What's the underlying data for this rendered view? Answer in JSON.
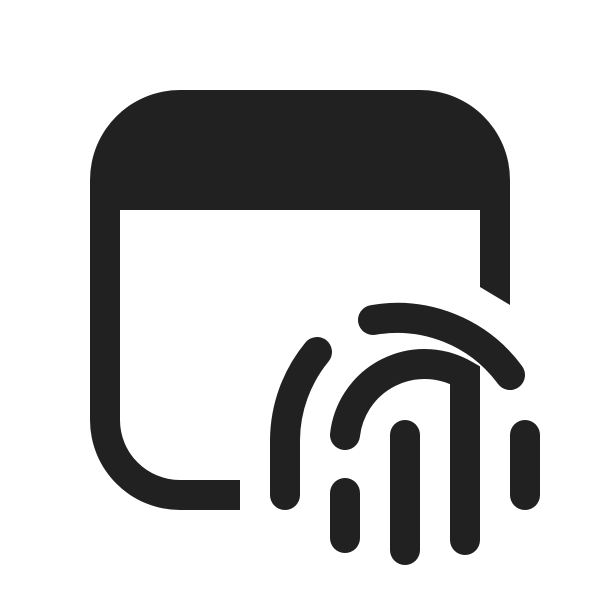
{
  "icon": {
    "name": "window-fingerprint-icon",
    "parts": [
      "window-frame-icon",
      "fingerprint-icon"
    ],
    "colors": {
      "background": "#ffffff",
      "foreground": "#212121"
    }
  }
}
